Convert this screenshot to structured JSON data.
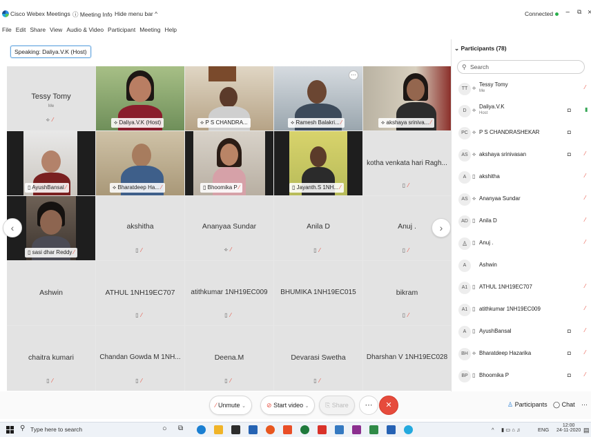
{
  "window": {
    "app_title": "Cisco Webex Meetings",
    "meeting_info": "Meeting Info",
    "hide_menu_bar": "Hide menu bar",
    "connected_label": "Connected"
  },
  "menu": [
    "File",
    "Edit",
    "Share",
    "View",
    "Audio & Video",
    "Participant",
    "Meeting",
    "Help"
  ],
  "speaking_label": "Speaking: Daliya.V.K (Host)",
  "grid": {
    "row1": [
      "Tessy Tomy",
      "Daliya.V.K (Host)",
      "P S CHANDRA...",
      "Ramesh Balakri...",
      "akshaya sriniva..."
    ],
    "me_label": "Me",
    "row2": [
      "AyushBansal",
      "Bharatdeep Ha...",
      "Bhoomika P",
      "Jayanth.S 1NH...",
      "kotha venkata hari Ragh..."
    ],
    "row3": [
      "sasi dhar Reddy",
      "akshitha",
      "Ananyaa Sundar",
      "Anila D",
      "Anuj ."
    ],
    "row4": [
      "Ashwin",
      "ATHUL 1NH19EC707",
      "atithkumar 1NH19EC009",
      "BHUMIKA 1NH19EC015",
      "bikram"
    ],
    "row5": [
      "chaitra kumari",
      "Chandan Gowda M 1NH...",
      "Deena.M",
      "Devarasi Swetha",
      "Dharshan V 1NH19EC028"
    ]
  },
  "panel": {
    "header": "Participants (78)",
    "search_placeholder": "Search",
    "participants": [
      {
        "initials": "TT",
        "name": "Tessy Tomy",
        "sub": "Me"
      },
      {
        "initials": "D",
        "name": "Daliya.V.K",
        "sub": "Host"
      },
      {
        "initials": "PC",
        "name": "P S CHANDRASHEKAR"
      },
      {
        "initials": "AS",
        "name": "akshaya srinivasan"
      },
      {
        "initials": "A",
        "name": "akshitha"
      },
      {
        "initials": "AS",
        "name": "Ananyaa Sundar"
      },
      {
        "initials": "AD",
        "name": "Anila D"
      },
      {
        "initials": "",
        "name": "Anuj ."
      },
      {
        "initials": "A",
        "name": "Ashwin"
      },
      {
        "initials": "A1",
        "name": "ATHUL 1NH19EC707"
      },
      {
        "initials": "A1",
        "name": "atithkumar 1NH19EC009"
      },
      {
        "initials": "A",
        "name": "AyushBansal"
      },
      {
        "initials": "BH",
        "name": "Bharatdeep Hazarika"
      },
      {
        "initials": "BP",
        "name": "Bhoomika P"
      }
    ]
  },
  "controls": {
    "unmute": "Unmute",
    "start_video": "Start video",
    "share": "Share",
    "participants": "Participants",
    "chat": "Chat"
  },
  "taskbar": {
    "search_placeholder": "Type here to search",
    "lang": "ENG",
    "time": "12:00",
    "date": "24-11-2020"
  },
  "colors": {
    "accent": "#3ca8e8",
    "end_red": "#e64b3c",
    "connected_green": "#2ab04d"
  }
}
